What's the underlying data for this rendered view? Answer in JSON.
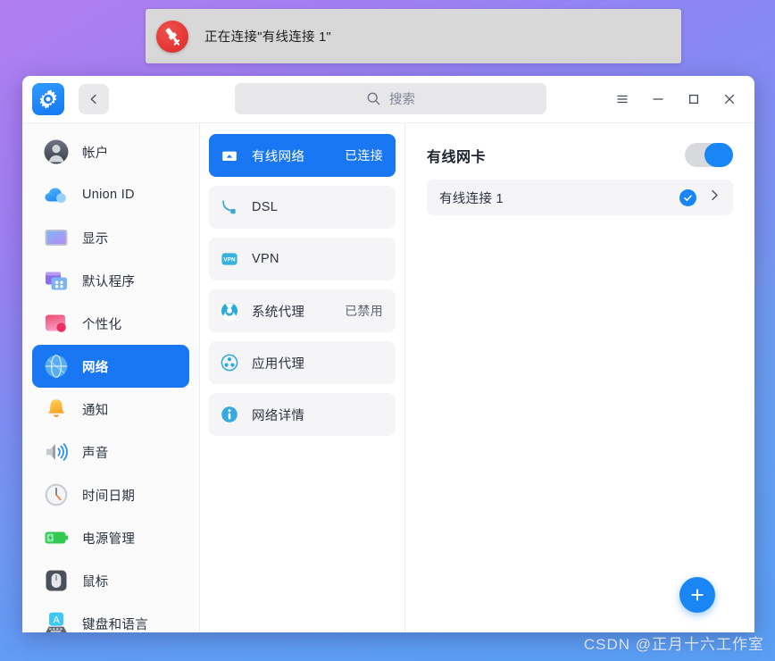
{
  "toast": {
    "icon": "network-disconnected-icon",
    "message": "正在连接\"有线连接 1\""
  },
  "titlebar": {
    "app_icon": "settings-gear-icon",
    "back_icon": "chevron-left-icon",
    "search": {
      "icon": "search-icon",
      "placeholder": "搜索",
      "value": ""
    },
    "controls": {
      "menu_icon": "hamburger-menu-icon",
      "minimize_icon": "minimize-icon",
      "maximize_icon": "maximize-icon",
      "close_icon": "close-icon"
    }
  },
  "sidebar": {
    "items": [
      {
        "label": "帐户",
        "icon": "account-avatar-icon",
        "active": false
      },
      {
        "label": "Union ID",
        "icon": "cloud-union-id-icon",
        "active": false
      },
      {
        "label": "显示",
        "icon": "display-monitor-icon",
        "active": false
      },
      {
        "label": "默认程序",
        "icon": "default-apps-icon",
        "active": false
      },
      {
        "label": "个性化",
        "icon": "personalization-icon",
        "active": false
      },
      {
        "label": "网络",
        "icon": "network-globe-icon",
        "active": true
      },
      {
        "label": "通知",
        "icon": "notification-bell-icon",
        "active": false
      },
      {
        "label": "声音",
        "icon": "sound-speaker-icon",
        "active": false
      },
      {
        "label": "时间日期",
        "icon": "clock-icon",
        "active": false
      },
      {
        "label": "电源管理",
        "icon": "battery-power-icon",
        "active": false
      },
      {
        "label": "鼠标",
        "icon": "mouse-icon",
        "active": false
      },
      {
        "label": "键盘和语言",
        "icon": "keyboard-language-icon",
        "active": false
      }
    ]
  },
  "network_list": {
    "items": [
      {
        "label": "有线网络",
        "status": "已连接",
        "icon": "wired-network-icon",
        "selected": true
      },
      {
        "label": "DSL",
        "status": "",
        "icon": "dsl-cable-icon",
        "selected": false
      },
      {
        "label": "VPN",
        "status": "",
        "icon": "vpn-badge-icon",
        "selected": false
      },
      {
        "label": "系统代理",
        "status": "已禁用",
        "icon": "system-proxy-icon",
        "selected": false
      },
      {
        "label": "应用代理",
        "status": "",
        "icon": "app-proxy-icon",
        "selected": false
      },
      {
        "label": "网络详情",
        "status": "",
        "icon": "info-circle-icon",
        "selected": false
      }
    ]
  },
  "detail_panel": {
    "title": "有线网卡",
    "toggle": {
      "name": "wired-adapter-toggle",
      "state": "on"
    },
    "connections": [
      {
        "name": "有线连接 1",
        "connected_icon": "check-circle-icon",
        "chevron_icon": "chevron-right-icon"
      }
    ],
    "add_button": {
      "icon": "plus-icon",
      "label": "+"
    }
  },
  "watermark": {
    "text": "CSDN @正月十六工作室"
  },
  "colors": {
    "accent_blue": "#1977f3",
    "toggle_blue": "#1a86f5",
    "toast_red": "#e53935",
    "panel_gray": "#f5f5f7"
  }
}
